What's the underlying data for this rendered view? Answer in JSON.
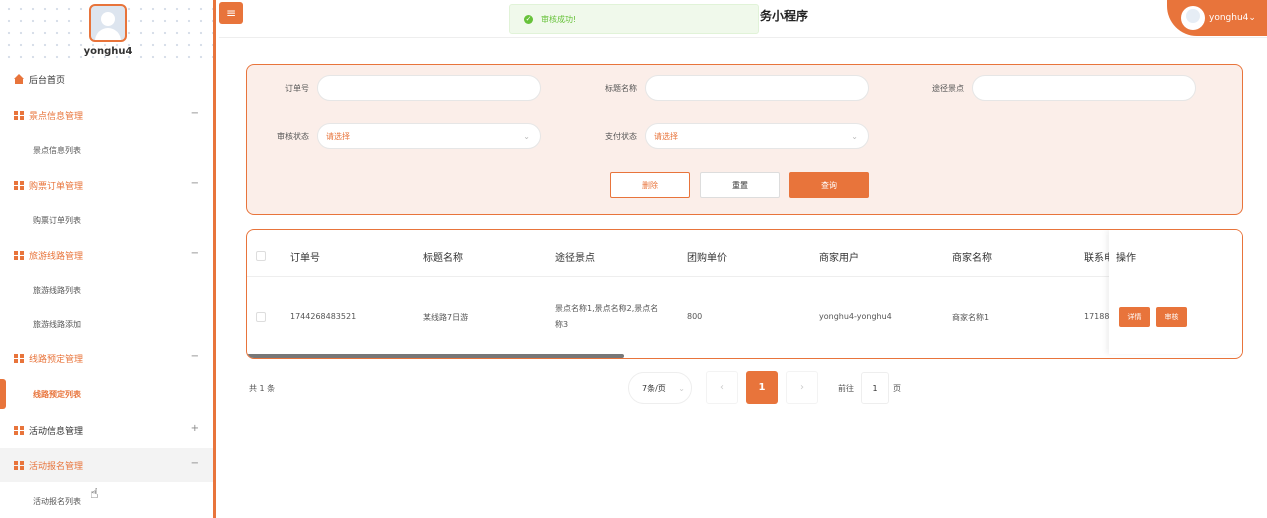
{
  "sidebar": {
    "username": "yonghu4",
    "items": [
      {
        "label": "后台首页"
      },
      {
        "label": "景点信息管理",
        "toggle": "−"
      },
      {
        "label": "景点信息列表"
      },
      {
        "label": "购票订单管理",
        "toggle": "−"
      },
      {
        "label": "购票订单列表"
      },
      {
        "label": "旅游线路管理",
        "toggle": "−"
      },
      {
        "label": "旅游线路列表"
      },
      {
        "label": "旅游线路添加"
      },
      {
        "label": "线路预定管理",
        "toggle": "−"
      },
      {
        "label": "线路预定列表"
      },
      {
        "label": "活动信息管理",
        "toggle": "+"
      },
      {
        "label": "活动报名管理",
        "toggle": "−"
      },
      {
        "label": "活动报名列表"
      }
    ]
  },
  "header": {
    "menu_icon": "≡",
    "title": "务小程序",
    "toast": "审核成功!",
    "user": "yonghu4",
    "user_caret": "⌄"
  },
  "search": {
    "order_no_label": "订单号",
    "title_label": "标题名称",
    "route_label": "途径景点",
    "audit_label": "审核状态",
    "audit_value": "请选择",
    "pay_label": "支付状态",
    "pay_value": "请选择",
    "delete_btn": "删除",
    "reset_btn": "重置",
    "query_btn": "查询"
  },
  "table": {
    "columns": [
      "订单号",
      "标题名称",
      "途径景点",
      "团购单价",
      "商家用户",
      "商家名称",
      "联系电",
      "操作"
    ],
    "rows": [
      {
        "order_no": "1744268483521",
        "title": "某线路7日游",
        "route_line1": "景点名称1,景点名称2,景点名",
        "route_line2": "称3",
        "price": "800",
        "merchant_user": "yonghu4-yonghu4",
        "merchant_name": "商家名称1",
        "phone": "17188",
        "detail_btn": "详情",
        "audit_btn": "审核"
      }
    ]
  },
  "pagination": {
    "total": "共 1 条",
    "page_size": "7条/页",
    "prev": "‹",
    "current": "1",
    "next": "›",
    "goto_prefix": "前往",
    "goto_value": "1",
    "goto_suffix": "页"
  },
  "colors": {
    "accent": "#e8743b",
    "success": "#67c23a",
    "panel_bg": "#fbeee9"
  }
}
